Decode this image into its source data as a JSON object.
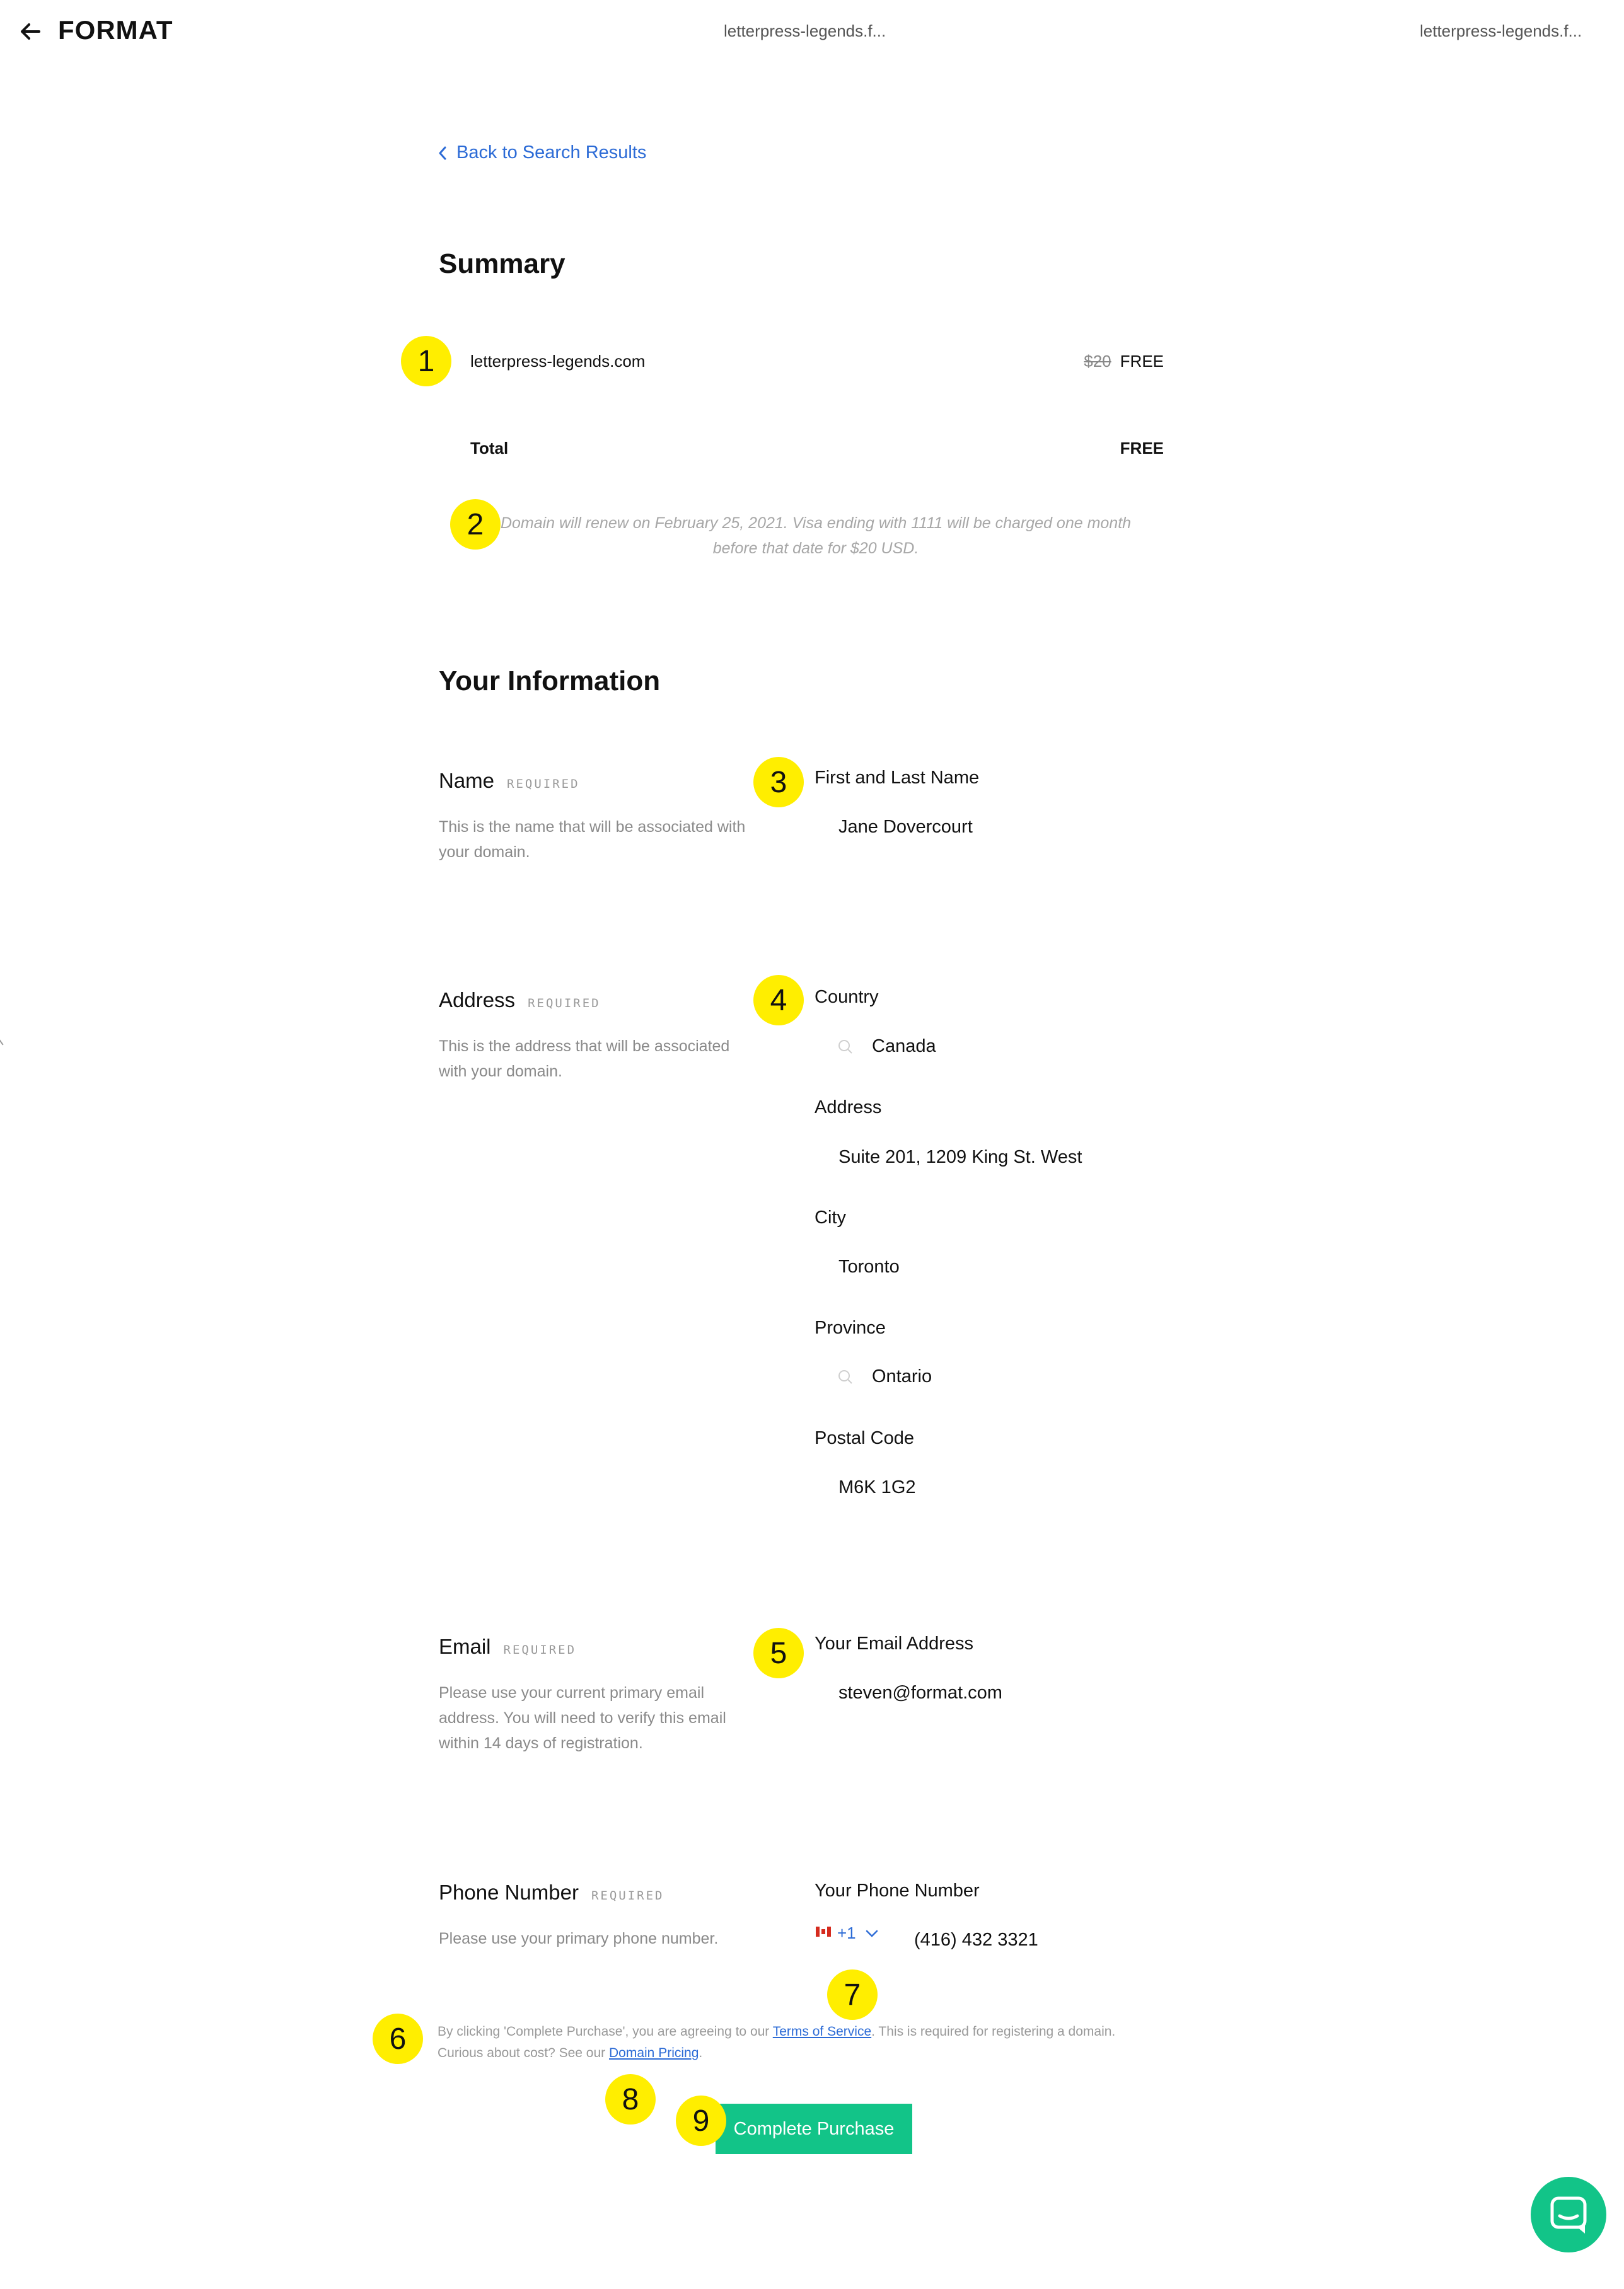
{
  "header": {
    "logo": "FORMAT",
    "tab_center": "letterpress-legends.f...",
    "tab_right": "letterpress-legends.f..."
  },
  "back_link": "Back to Search Results",
  "summary": {
    "heading": "Summary",
    "item_domain": "letterpress-legends.com",
    "item_original_price": "$20",
    "item_price": "FREE",
    "total_label": "Total",
    "total_value": "FREE",
    "renewal_note": "Domain will renew on February 25, 2021. Visa ending with 1111 will be charged one month before that date for $20 USD."
  },
  "info": {
    "heading": "Your Information",
    "required_tag": "REQUIRED",
    "name": {
      "title": "Name",
      "help": "This is the name that will be associated with your domain.",
      "input_label": "First and Last Name",
      "input_value": "Jane Dovercourt"
    },
    "address": {
      "title": "Address",
      "help": "This is the address that will be associated with your domain.",
      "country_label": "Country",
      "country_value": "Canada",
      "street_label": "Address",
      "street_value": "Suite 201, 1209 King St. West",
      "city_label": "City",
      "city_value": "Toronto",
      "province_label": "Province",
      "province_value": "Ontario",
      "postal_label": "Postal Code",
      "postal_value": "M6K 1G2"
    },
    "email": {
      "title": "Email",
      "help": "Please use your current primary email address. You will need to verify this email within 14 days of registration.",
      "input_label": "Your Email Address",
      "input_value": "steven@format.com"
    },
    "phone": {
      "title": "Phone Number",
      "help": "Please use your primary phone number.",
      "input_label": "Your Phone Number",
      "country_code": "+1",
      "input_value": "(416) 432 3321"
    }
  },
  "legal": {
    "text_1": "By clicking 'Complete Purchase', you are agreeing to our ",
    "terms_link": "Terms of Service",
    "text_2": ". This is required for registering a domain.",
    "text_3": "Curious about cost? See our ",
    "pricing_link": "Domain Pricing",
    "text_4": "."
  },
  "cta": "Complete Purchase",
  "markers": [
    "1",
    "2",
    "3",
    "4",
    "5",
    "6",
    "7",
    "8",
    "9"
  ],
  "colors": {
    "accent_green": "#12c488",
    "link_blue": "#2c6bd6",
    "marker_yellow": "#ffee00"
  },
  "icons": [
    "back-arrow-icon",
    "chevron-left-icon",
    "search-icon",
    "canada-flag-icon",
    "chevron-down-icon",
    "chat-icon"
  ]
}
